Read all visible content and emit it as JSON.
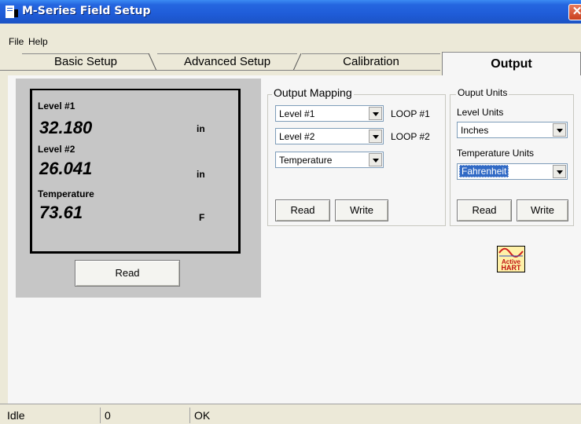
{
  "window": {
    "title": "M-Series Field Setup",
    "close_glyph": "✕"
  },
  "menu": {
    "items": [
      "File",
      "Help"
    ]
  },
  "tabs": [
    {
      "label": "Basic Setup"
    },
    {
      "label": "Advanced Setup"
    },
    {
      "label": "Calibration"
    },
    {
      "label": "Output",
      "active": true
    }
  ],
  "display": {
    "level1": {
      "label": "Level #1",
      "value": "32.180",
      "unit": "in"
    },
    "level2": {
      "label": "Level #2",
      "value": "26.041",
      "unit": "in"
    },
    "temperature": {
      "label": "Temperature",
      "value": "73.61",
      "unit": "F"
    },
    "read_label": "Read"
  },
  "output_mapping": {
    "title": "Output Mapping",
    "rows": [
      {
        "value": "Level #1",
        "loop": "LOOP #1"
      },
      {
        "value": "Level #2",
        "loop": "LOOP #2"
      },
      {
        "value": "Temperature",
        "loop": ""
      }
    ],
    "read_label": "Read",
    "write_label": "Write"
  },
  "output_units": {
    "title": "Ouput Units",
    "level_label": "Level Units",
    "level_value": "Inches",
    "temp_label": "Temperature Units",
    "temp_value": "Fahrenheit",
    "read_label": "Read",
    "write_label": "Write"
  },
  "badge": {
    "icon": "active-hart-icon",
    "line1": "Active",
    "line2": "HART"
  },
  "status": {
    "state": "Idle",
    "count": "0",
    "message": "OK"
  },
  "colors": {
    "titlebar": "#1f5cd8",
    "selection": "#316ac5",
    "display_bg": "#c6c6c6"
  }
}
